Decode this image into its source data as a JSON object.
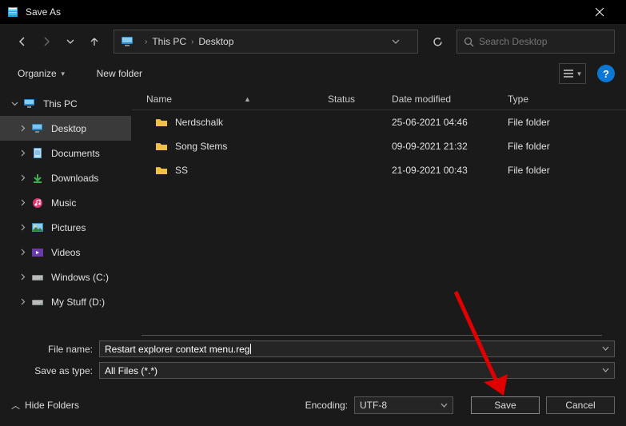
{
  "title": "Save As",
  "breadcrumbs": [
    "This PC",
    "Desktop"
  ],
  "search": {
    "placeholder": "Search Desktop"
  },
  "toolbar": {
    "organize": "Organize",
    "newfolder": "New folder"
  },
  "nav": {
    "root": "This PC",
    "items": [
      {
        "label": "Desktop",
        "icon": "desktop",
        "sel": true
      },
      {
        "label": "Documents",
        "icon": "doc"
      },
      {
        "label": "Downloads",
        "icon": "down"
      },
      {
        "label": "Music",
        "icon": "music"
      },
      {
        "label": "Pictures",
        "icon": "pic"
      },
      {
        "label": "Videos",
        "icon": "vid"
      },
      {
        "label": "Windows (C:)",
        "icon": "drive"
      },
      {
        "label": "My Stuff (D:)",
        "icon": "drive"
      }
    ]
  },
  "columns": {
    "name": "Name",
    "status": "Status",
    "date": "Date modified",
    "type": "Type"
  },
  "rows": [
    {
      "name": "Nerdschalk",
      "date": "25-06-2021 04:46",
      "type": "File folder"
    },
    {
      "name": "Song Stems",
      "date": "09-09-2021 21:32",
      "type": "File folder"
    },
    {
      "name": "SS",
      "date": "21-09-2021 00:43",
      "type": "File folder"
    }
  ],
  "filename": {
    "label": "File name:",
    "value": "Restart explorer context menu.reg"
  },
  "savetype": {
    "label": "Save as type:",
    "value": "All Files  (*.*)"
  },
  "encoding": {
    "label": "Encoding:",
    "value": "UTF-8"
  },
  "footer": {
    "hide": "Hide Folders",
    "save": "Save",
    "cancel": "Cancel"
  },
  "help": "?"
}
